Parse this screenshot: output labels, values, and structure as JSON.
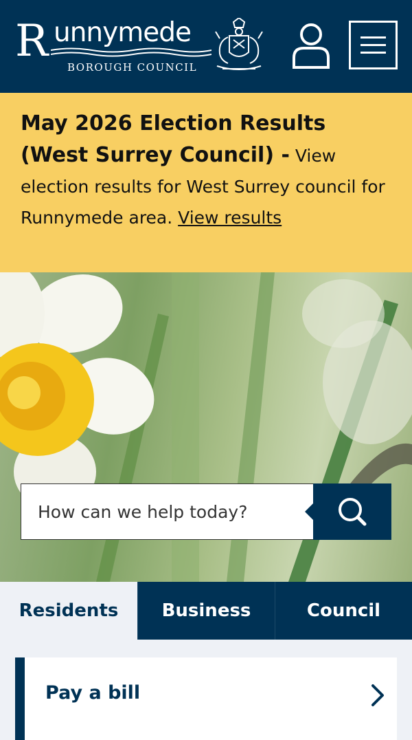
{
  "header": {
    "logo_initial": "R",
    "logo_word": "unnymede",
    "logo_subtitle": "BOROUGH COUNCIL",
    "icons": {
      "account": "user-icon",
      "menu": "hamburger-icon",
      "crest": "coat-of-arms-icon"
    }
  },
  "alert": {
    "title": "May 2026 Election Results (West Surrey Council) -",
    "body": "View election results for West Surrey council for Runnymede area.",
    "link_label": "View results"
  },
  "search": {
    "placeholder": "How can we help today?",
    "icon": "search-icon"
  },
  "tabs": [
    {
      "label": "Residents",
      "active": true
    },
    {
      "label": "Business",
      "active": false
    },
    {
      "label": "Council",
      "active": false
    }
  ],
  "cards": [
    {
      "label": "Pay a bill",
      "icon": "chevron-right-icon"
    }
  ],
  "colors": {
    "brand_navy": "#003255",
    "alert_yellow": "#f8cf62",
    "page_bg": "#eef1f6"
  }
}
